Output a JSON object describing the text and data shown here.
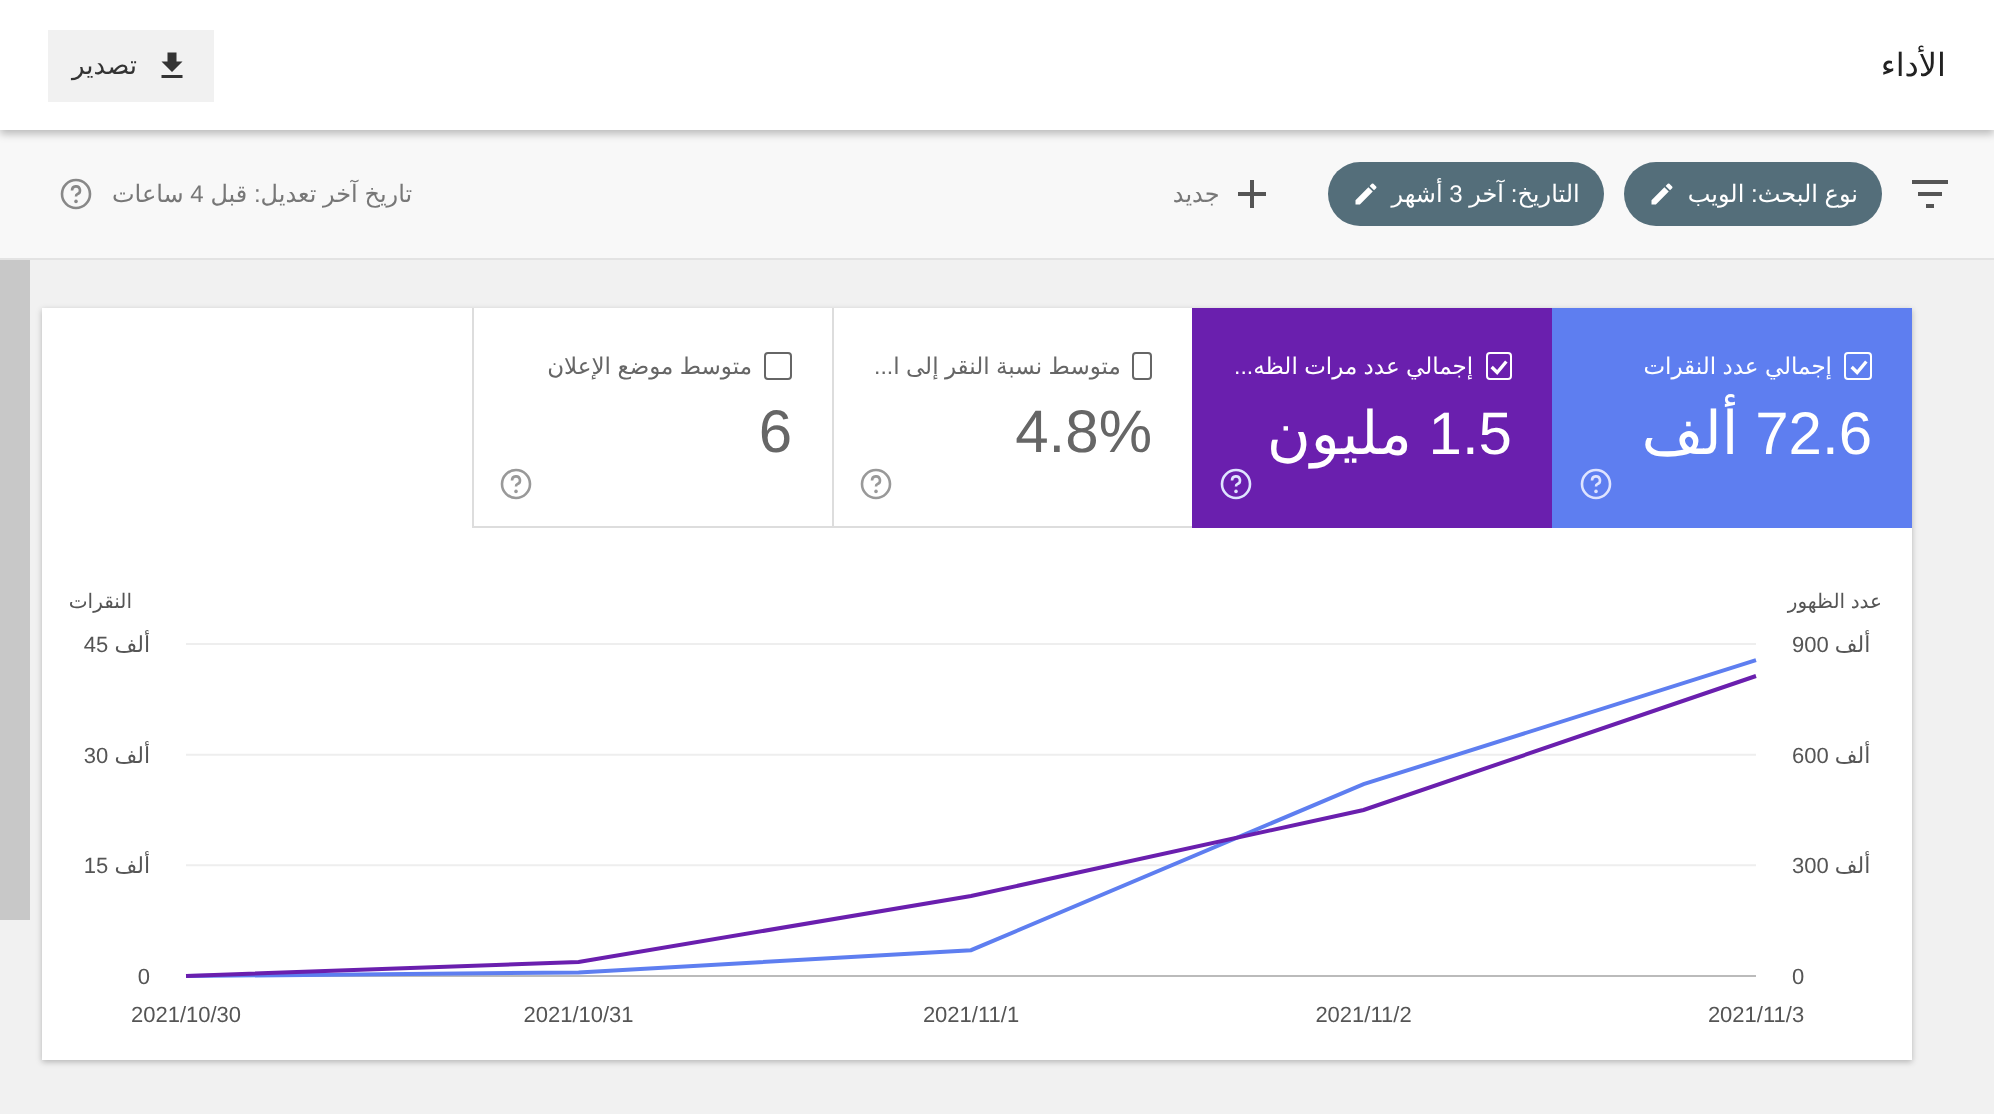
{
  "header": {
    "title": "الأداء",
    "export_button": "تصدير"
  },
  "filters": {
    "chips": [
      {
        "label": "نوع البحث: الويب"
      },
      {
        "label": "التاريخ: آخر 3 أشهر"
      }
    ],
    "new_button": "جديد",
    "last_updated": "تاريخ آخر تعديل: قبل 4 ساعات"
  },
  "metrics": [
    {
      "label": "إجمالي عدد النقرات",
      "value": "72.6 ألف",
      "checked": true,
      "color": "#5e7ef0"
    },
    {
      "label": "إجمالي عدد مرات الظه...",
      "value": "1.5 مليون",
      "checked": true,
      "color": "#6a1fae"
    },
    {
      "label": "متوسط نسبة النقر إلى ا...",
      "value": "4.8%",
      "checked": false
    },
    {
      "label": "متوسط موضع الإعلان",
      "value": "6",
      "checked": false
    }
  ],
  "chart": {
    "chart_data": {
      "type": "line",
      "ylabel": "النقرات",
      "y2label": "عدد الظهور",
      "categories": [
        "2021/10/30",
        "2021/10/31",
        "2021/11/1",
        "2021/11/2",
        "2021/11/3"
      ],
      "ylim": [
        0,
        45
      ],
      "yticks": [
        {
          "value": 0,
          "label": "0"
        },
        {
          "value": 15,
          "label": "15 ألف"
        },
        {
          "value": 30,
          "label": "30 ألف"
        },
        {
          "value": 45,
          "label": "45 ألف"
        }
      ],
      "y2lim": [
        0,
        900
      ],
      "y2ticks": [
        {
          "value": 0,
          "label": "0"
        },
        {
          "value": 300,
          "label": "300 ألف"
        },
        {
          "value": 600,
          "label": "600 ألف"
        },
        {
          "value": 900,
          "label": "900 ألف"
        }
      ],
      "series": [
        {
          "color": "#5e7ef0",
          "values": [
            0,
            0.5,
            3.5,
            26,
            42.8
          ]
        },
        {
          "color": "#6a1fae",
          "axis": "y2",
          "values": [
            0,
            38,
            217,
            450,
            813
          ]
        }
      ]
    }
  }
}
